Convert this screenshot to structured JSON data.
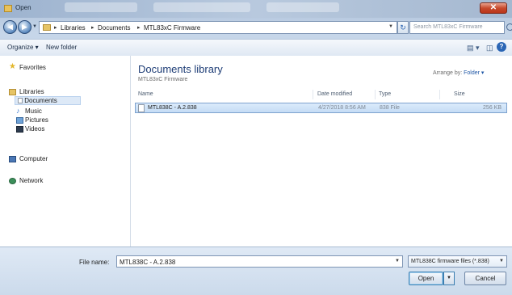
{
  "window": {
    "title": "Open",
    "close_glyph": "✕",
    "accent": "#1e3d76"
  },
  "address": {
    "crumbs": [
      "Libraries",
      "Documents",
      "MTL83xC Firmware"
    ],
    "search_placeholder": "Search MTL83xC Firmware",
    "refresh_glyph": "↻"
  },
  "toolbar": {
    "organize_label": "Organize ▾",
    "new_folder_label": "New folder",
    "views_glyph": "▤ ▾",
    "preview_glyph": "◫",
    "help_glyph": "?"
  },
  "navpane": {
    "favorites": "Favorites",
    "libraries": "Libraries",
    "documents": "Documents",
    "music": "Music",
    "pictures": "Pictures",
    "videos": "Videos",
    "computer": "Computer",
    "network": "Network"
  },
  "content": {
    "library_title": "Documents library",
    "library_subtitle": "MTL83xC Firmware",
    "arrange_label": "Arrange by:",
    "arrange_value": "Folder ▾",
    "columns": [
      "Name",
      "Date modified",
      "Type",
      "Size"
    ],
    "files": [
      {
        "name": "MTL838C - A.2.838",
        "date": "4/27/2018 8:56 AM",
        "type": "838 File",
        "size": "256 KB"
      }
    ]
  },
  "footer": {
    "file_name_label": "File name:",
    "file_name_value": "MTL838C - A.2.838",
    "file_type_value": "MTL838C firmware files (*.838)",
    "open_label": "Open",
    "cancel_label": "Cancel",
    "dropdown_glyph": "▼"
  }
}
